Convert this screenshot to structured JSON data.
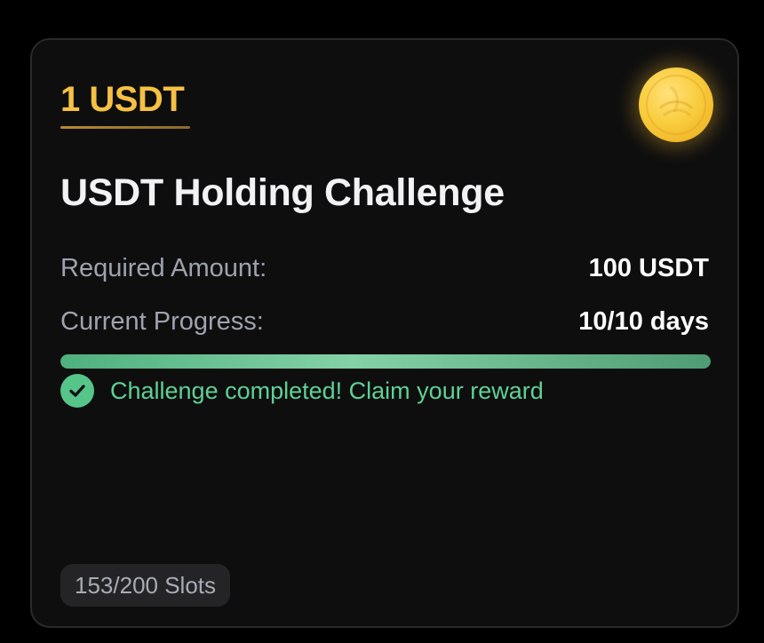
{
  "card": {
    "reward": "1 USDT",
    "title": "USDT Holding Challenge",
    "rows": [
      {
        "label": "Required Amount:",
        "value": "100 USDT"
      },
      {
        "label": "Current Progress:",
        "value": "10/10 days"
      }
    ],
    "progress_fraction": 1.0,
    "status_text": "Challenge completed! Claim your reward",
    "slots": "153/200 Slots",
    "icons": {
      "coin": "gold-coin-icon",
      "status": "check-circle-icon"
    }
  },
  "colors": {
    "reward": "#f5c043",
    "progress": "#56c58a",
    "status": "#5fd195",
    "card_bg": "#0e0e0f"
  }
}
